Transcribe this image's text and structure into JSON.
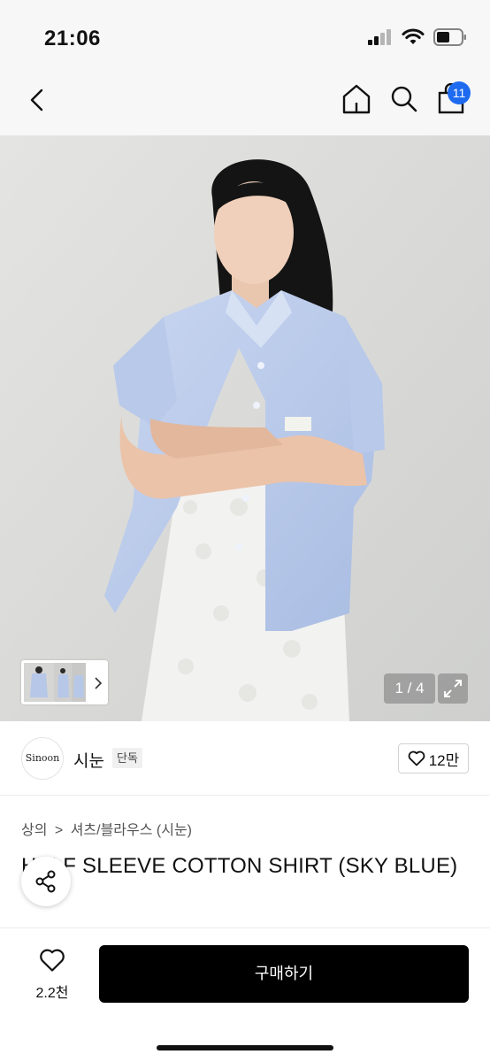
{
  "status_bar": {
    "time": "21:06"
  },
  "nav": {
    "back_icon": "chevron-left-icon",
    "home_icon": "home-icon",
    "search_icon": "search-icon",
    "bag_icon": "shopping-bag-icon",
    "bag_badge": "11",
    "badge_color": "#1e6bf0"
  },
  "gallery": {
    "counter": "1 / 4",
    "current_image": 1,
    "total_images": 4,
    "expand_icon": "expand-icon",
    "thumbnail_chevron_icon": "chevron-right-icon"
  },
  "brand": {
    "logo_text": "Sinoon",
    "name": "시눈",
    "tag": "단독",
    "like_icon": "heart-outline-icon",
    "like_count": "12만"
  },
  "product": {
    "breadcrumb": [
      "상의",
      ">",
      "셔츠/블라우스 (시눈)"
    ],
    "title": "HALF SLEEVE COTTON SHIRT (SKY BLUE)"
  },
  "share": {
    "icon": "share-icon"
  },
  "bottom_bar": {
    "wish_icon": "heart-outline-icon",
    "wish_count": "2.2천",
    "buy_label": "구매하기",
    "buy_color": "#000000"
  }
}
